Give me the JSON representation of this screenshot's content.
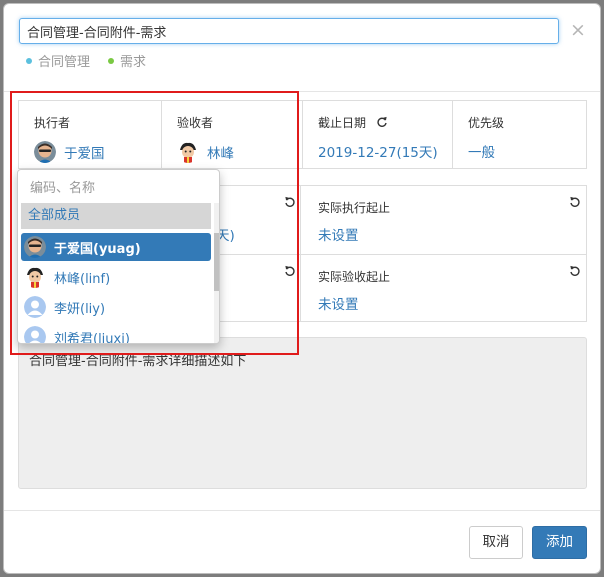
{
  "header": {
    "title_value": "合同管理-合同附件-需求",
    "close_glyph": "×",
    "tags": [
      {
        "label": "合同管理",
        "color": "#5bc0de"
      },
      {
        "label": "需求",
        "color": "#7ac943"
      }
    ]
  },
  "fields": {
    "assignee": {
      "label": "执行者",
      "value": "于爱国"
    },
    "acceptor": {
      "label": "验收者",
      "value": "林峰"
    },
    "deadline": {
      "label": "截止日期",
      "value": "2019-12-27(15天)"
    },
    "priority": {
      "label": "优先级",
      "value": "一般"
    }
  },
  "schedule": {
    "plan_exec_partial": "天)",
    "actual_exec": {
      "label": "实际执行起止",
      "value": "未设置"
    },
    "actual_accept": {
      "label": "实际验收起止",
      "value": "未设置"
    }
  },
  "description": "合同管理-合同附件-需求详细描述如下",
  "footer": {
    "cancel": "取消",
    "add": "添加"
  },
  "dropdown": {
    "placeholder": "编码、名称",
    "group": "全部成员",
    "items": [
      {
        "label": "于爱国(yuag)",
        "active": true
      },
      {
        "label": "林峰(linf)",
        "active": false
      },
      {
        "label": "李妍(liy)",
        "active": false
      },
      {
        "label": "刘希君(liuxj)",
        "active": false
      }
    ]
  },
  "colors": {
    "primary": "#337ab7",
    "highlight_box": "#e01b1b"
  }
}
